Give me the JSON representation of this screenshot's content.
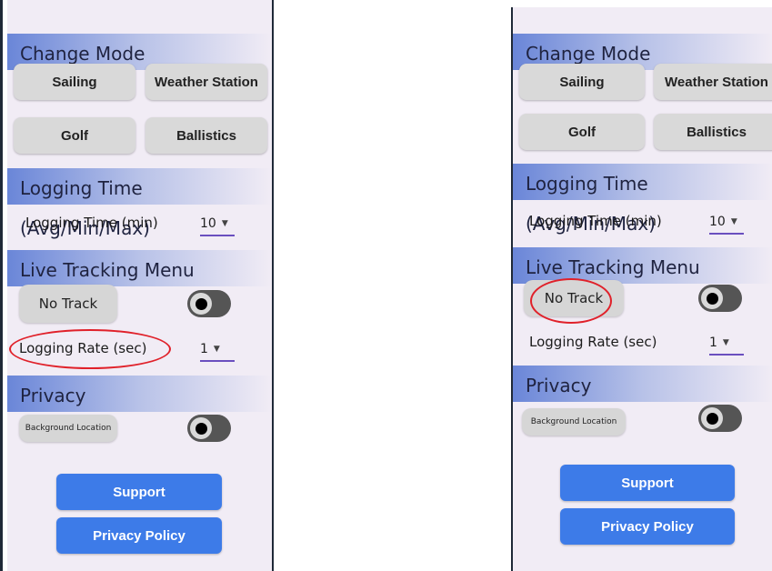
{
  "screens": [
    {
      "change_mode": {
        "title": "Change Mode",
        "buttons": [
          "Sailing",
          "Weather Station",
          "Golf",
          "Ballistics"
        ]
      },
      "logging_time": {
        "title": "Logging Time (Avg/Min/Max)",
        "label": "Logging Time (min)",
        "value": "10"
      },
      "live_tracking": {
        "title": "Live Tracking Menu",
        "no_track": "No Track",
        "toggle_on": false,
        "rate_label": "Logging Rate (sec)",
        "rate_value": "1"
      },
      "privacy": {
        "title": "Privacy",
        "background_location": "Background Location",
        "toggle_on": false
      },
      "support": "Support",
      "privacy_policy": "Privacy Policy",
      "highlighted": "Logging Rate (sec)"
    },
    {
      "change_mode": {
        "title": "Change Mode",
        "buttons": [
          "Sailing",
          "Weather Station",
          "Golf",
          "Ballistics"
        ]
      },
      "logging_time": {
        "title": "Logging Time (Avg/Min/Max)",
        "label": "Logging Time (min)",
        "value": "10"
      },
      "live_tracking": {
        "title": "Live Tracking Menu",
        "no_track": "No Track",
        "toggle_on": false,
        "rate_label": "Logging Rate (sec)",
        "rate_value": "1"
      },
      "privacy": {
        "title": "Privacy",
        "background_location": "Background Location",
        "toggle_on": false
      },
      "support": "Support",
      "privacy_policy": "Privacy Policy",
      "highlighted": "No Track"
    }
  ],
  "colors": {
    "accent_blue": "#3d7be8",
    "highlight_circle": "#e0212a",
    "panel_bg": "#f1ecf5"
  }
}
